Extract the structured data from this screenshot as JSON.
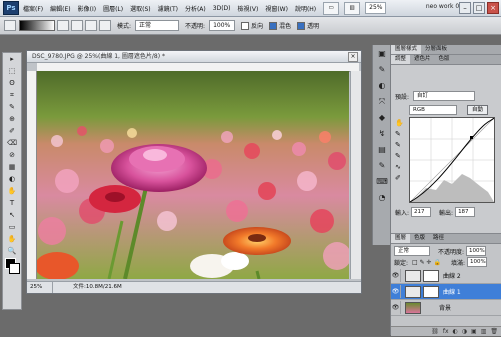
{
  "app": {
    "logo": "Ps",
    "workspace_name": "neo work 01"
  },
  "menu": [
    "檔案(F)",
    "編輯(E)",
    "影像(I)",
    "圖層(L)",
    "選取(S)",
    "濾鏡(T)",
    "分析(A)",
    "3D(D)",
    "檢視(V)",
    "視窗(W)",
    "說明(H)"
  ],
  "menu_controls": [
    "▭",
    "▥",
    "✋",
    "🔍"
  ],
  "zoom_level": "25%",
  "window_buttons": {
    "minimize": "–",
    "maximize": "□",
    "close": "×"
  },
  "options_bar": {
    "mode_label": "模式:",
    "mode_value": "正常",
    "opacity_label": "不透明:",
    "opacity_value": "100%",
    "reverse_label": "反向",
    "dither_label": "混色",
    "transparency_label": "透明"
  },
  "tools": [
    "▸",
    "⬚",
    "ʘ",
    "⌗",
    "✎",
    "⊕",
    "✐",
    "⌫",
    "⊘",
    "▦",
    "◐",
    "✋",
    "T",
    "↖",
    "▭",
    "✋",
    "🔍"
  ],
  "document": {
    "title": "DSC_9780.JPG @ 25%(曲線 1, 圖層遮色片/8) *",
    "close_glyph": "×",
    "status_zoom": "25%",
    "status_doc": "文件:10.8M/21.6M"
  },
  "dock_icons": [
    "▣",
    "✎",
    "◐",
    "⤧",
    "◆",
    "↯",
    "▤",
    "✎",
    "⌨",
    "◔"
  ],
  "panels": {
    "top_tabs": [
      "圖層樣式",
      "分層面板"
    ],
    "tabs2": [
      "調整",
      "遮色片",
      "色版"
    ],
    "preset_label": "預設:",
    "preset_value": "自訂",
    "channel_value": "RGB",
    "auto_button": "自動",
    "input_label": "輸入:",
    "input_value": "217",
    "output_label": "輸出:",
    "output_value": "187"
  },
  "layers_panel": {
    "tabs": [
      "圖層",
      "色版",
      "路徑"
    ],
    "blend_mode": "正常",
    "opacity_label": "不透明度:",
    "opacity_value": "100%",
    "lock_label": "鎖定:",
    "fill_label": "填滿:",
    "fill_value": "100%",
    "layers": [
      {
        "name": "曲線 2",
        "visible": true,
        "selected": false
      },
      {
        "name": "曲線 1",
        "visible": true,
        "selected": true
      },
      {
        "name": "背景",
        "visible": true,
        "selected": false
      }
    ],
    "footer_icons": [
      "⛓",
      "fx",
      "◐",
      "◑",
      "▣",
      "▥",
      "🗑"
    ]
  },
  "colors": {
    "selected_layer": "#3f7fd8",
    "app_bg": "#6b6b6b",
    "panel_bg": "#c9cbce"
  }
}
